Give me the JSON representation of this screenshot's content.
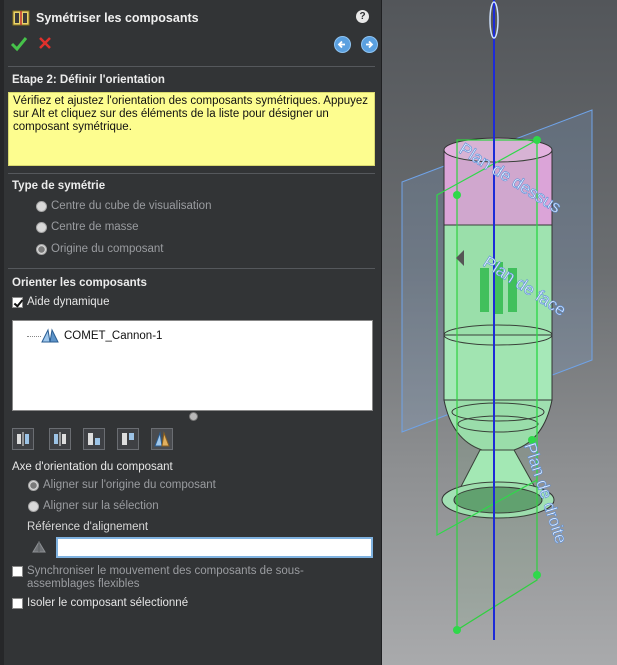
{
  "header": {
    "title": "Symétriser les composants",
    "help_glyph": "?"
  },
  "step": {
    "title": "Etape 2: Définir l'orientation",
    "message": "Vérifiez et ajustez l'orientation des composants symétriques. Appuyez sur Alt et cliquez sur des éléments de la liste pour désigner un composant symétrique."
  },
  "symmetry": {
    "title": "Type de symétrie",
    "options": [
      {
        "label": "Centre du cube de visualisation",
        "selected": false
      },
      {
        "label": "Centre de masse",
        "selected": false
      },
      {
        "label": "Origine du composant",
        "selected": true
      }
    ]
  },
  "orient": {
    "title": "Orienter les composants",
    "dynamic_help": {
      "label": "Aide dynamique",
      "checked": true
    },
    "list_items": [
      "COMET_Cannon-1"
    ],
    "axis_title": "Axe d'orientation du composant",
    "axis_options": [
      {
        "label": "Aligner sur l'origine du composant",
        "selected": true
      },
      {
        "label": "Aligner sur la sélection",
        "selected": false
      }
    ],
    "reference_title": "Référence d'alignement",
    "reference_value": "",
    "sync": {
      "label": "Synchroniser le mouvement des composants de sous-assemblages flexibles",
      "checked": false
    },
    "isolate": {
      "label": "Isoler le composant sélectionné",
      "checked": false
    }
  },
  "viewport": {
    "plane_top": "Plan de dessus",
    "plane_front": "Plan de face",
    "plane_right": "Plan de droite"
  },
  "colors": {
    "accent_blue": "#5aa0e0",
    "ok_green": "#46c24a",
    "cancel_red": "#e0312c",
    "message_bg": "#fdfd8f"
  },
  "icons": {
    "ok": "check-icon",
    "cancel": "close-icon",
    "back": "arrow-left-icon",
    "next": "arrow-right-icon"
  }
}
